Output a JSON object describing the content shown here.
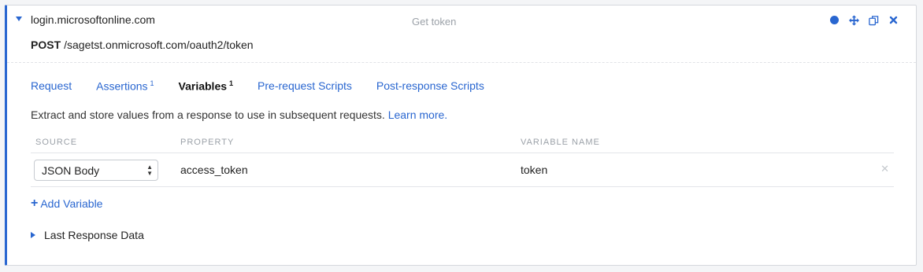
{
  "request": {
    "host": "login.microsoftonline.com",
    "title": "Get token",
    "method": "POST",
    "path": "/sagetst.onmicrosoft.com/oauth2/token"
  },
  "header_icons": [
    "status-dot-icon",
    "move-icon",
    "duplicate-icon",
    "close-icon"
  ],
  "tabs": [
    {
      "label": "Request",
      "badge": ""
    },
    {
      "label": "Assertions",
      "badge": "1"
    },
    {
      "label": "Variables",
      "badge": "1"
    },
    {
      "label": "Pre-request Scripts",
      "badge": ""
    },
    {
      "label": "Post-response Scripts",
      "badge": ""
    }
  ],
  "active_tab": "Variables",
  "description": {
    "text": "Extract and store values from a response to use in subsequent requests.",
    "link": "Learn more."
  },
  "table": {
    "headers": [
      "SOURCE",
      "PROPERTY",
      "VARIABLE NAME"
    ],
    "rows": [
      {
        "source": "JSON Body",
        "property": "access_token",
        "variable_name": "token"
      }
    ]
  },
  "add_variable_label": "Add Variable",
  "last_response_label": "Last Response Data",
  "colors": {
    "accent": "#2966d0",
    "muted": "#9ba1a8"
  }
}
